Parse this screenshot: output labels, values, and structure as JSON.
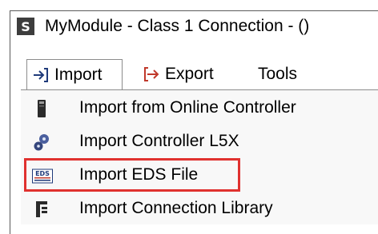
{
  "window": {
    "app_icon_letter": "S",
    "title": "MyModule - Class 1 Connection -  ()"
  },
  "menubar": {
    "tabs": [
      {
        "label": "Import",
        "icon": "import-arrow-icon",
        "active": true
      },
      {
        "label": "Export",
        "icon": "export-arrow-icon",
        "active": false
      },
      {
        "label": "Tools",
        "active": false
      }
    ]
  },
  "import_menu": {
    "items": [
      {
        "label": "Import from Online Controller",
        "icon": "controller-icon"
      },
      {
        "label": "Import Controller L5X",
        "icon": "gears-icon"
      },
      {
        "label": "Import EDS File",
        "icon": "eds-file-icon",
        "icon_text": "EDS",
        "highlighted": true
      },
      {
        "label": "Import Connection Library",
        "icon": "connection-library-icon"
      }
    ]
  },
  "colors": {
    "highlight": "#e0312f",
    "import_arrow": "#1f3a7a",
    "export_arrow": "#c0392b"
  }
}
